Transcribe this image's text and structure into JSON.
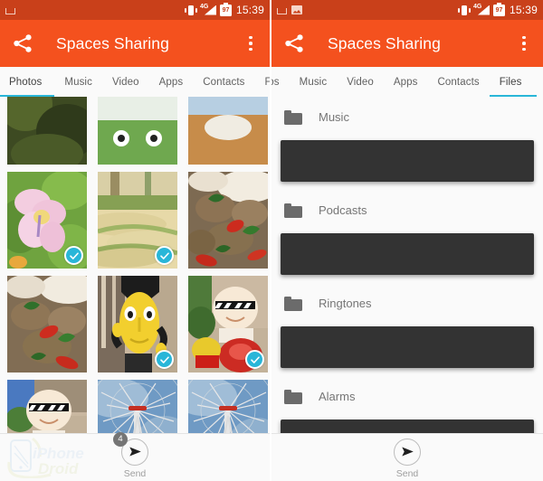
{
  "status_bar": {
    "left_icons": [
      "keyboard-icon",
      "picture-icon"
    ],
    "vibrate_icon": "vibrate-icon",
    "network_label": "4G",
    "battery_level": "97",
    "time": "15:39"
  },
  "app_bar": {
    "share_icon": "share-icon",
    "title": "Spaces Sharing",
    "overflow_icon": "overflow-menu-icon"
  },
  "theme": {
    "status_bar_color": "#c9401a",
    "app_bar_color": "#f4511e",
    "accent_color": "#29b6d8",
    "background_color": "#fafafa",
    "redacted_color": "#333333"
  },
  "left_panel": {
    "tabs": [
      {
        "label": "Photos",
        "selected": true
      },
      {
        "label": "Music",
        "selected": false
      },
      {
        "label": "Video",
        "selected": false
      },
      {
        "label": "Apps",
        "selected": false
      },
      {
        "label": "Contacts",
        "selected": false
      },
      {
        "label": "Ftos",
        "selected": false
      }
    ],
    "photos": [
      {
        "name": "photo-dark-foliage",
        "selected": false
      },
      {
        "name": "photo-green-face",
        "selected": false
      },
      {
        "name": "photo-sky-bowl",
        "selected": false
      },
      {
        "name": "photo-pink-flower",
        "selected": true
      },
      {
        "name": "photo-grass-field",
        "selected": true
      },
      {
        "name": "photo-thai-basil-pork-rice",
        "selected": false
      },
      {
        "name": "photo-thai-basil-pork-rice-2",
        "selected": false
      },
      {
        "name": "photo-yellow-mask-figure",
        "selected": true
      },
      {
        "name": "photo-sunglasses-mascot-red",
        "selected": true
      },
      {
        "name": "photo-sunglasses-mascot-scooter",
        "selected": false
      },
      {
        "name": "photo-ferris-wheel",
        "selected": false
      },
      {
        "name": "photo-ferris-wheel-2",
        "selected": false
      }
    ],
    "send": {
      "label": "Send",
      "badge_count": "4",
      "icon": "send-icon"
    },
    "watermark": {
      "line1": "iPhone",
      "line2": "Droid"
    }
  },
  "right_panel": {
    "tabs": [
      {
        "label": "tos",
        "selected": false
      },
      {
        "label": "Music",
        "selected": false
      },
      {
        "label": "Video",
        "selected": false
      },
      {
        "label": "Apps",
        "selected": false
      },
      {
        "label": "Contacts",
        "selected": false
      },
      {
        "label": "Files",
        "selected": true
      }
    ],
    "files": [
      {
        "type": "folder",
        "label": "Music"
      },
      {
        "type": "redacted",
        "label": ""
      },
      {
        "type": "folder",
        "label": "Podcasts"
      },
      {
        "type": "redacted",
        "label": ""
      },
      {
        "type": "folder",
        "label": "Ringtones"
      },
      {
        "type": "redacted",
        "label": ""
      },
      {
        "type": "folder",
        "label": "Alarms"
      },
      {
        "type": "redacted",
        "label": ""
      }
    ],
    "send": {
      "label": "Send",
      "badge_count": "",
      "icon": "send-icon"
    }
  }
}
